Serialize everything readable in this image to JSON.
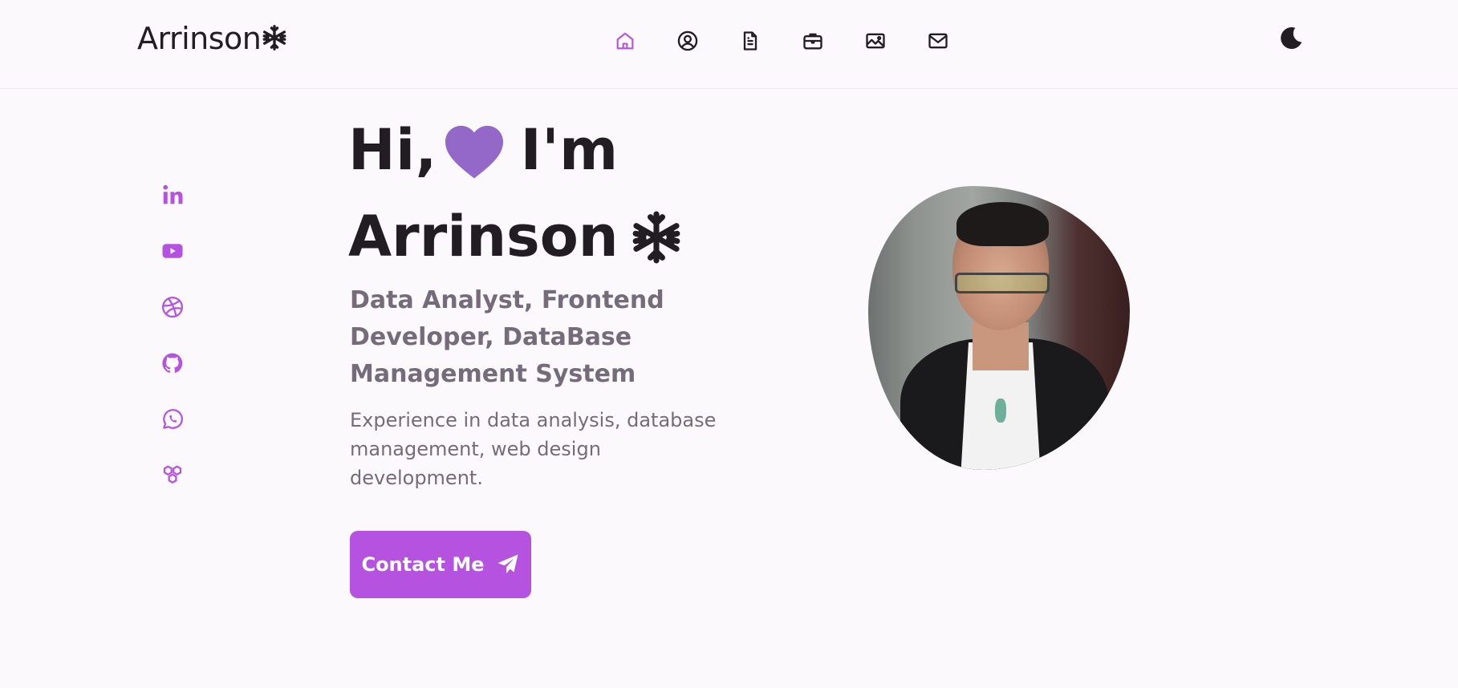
{
  "header": {
    "logo_text": "Arrinson",
    "nav": [
      {
        "name": "home",
        "icon": "home-icon",
        "active": true
      },
      {
        "name": "about",
        "icon": "user-circle-icon",
        "active": false
      },
      {
        "name": "skills",
        "icon": "file-icon",
        "active": false
      },
      {
        "name": "services",
        "icon": "briefcase-icon",
        "active": false
      },
      {
        "name": "portfolio",
        "icon": "image-icon",
        "active": false
      },
      {
        "name": "contact",
        "icon": "mail-icon",
        "active": false
      }
    ],
    "theme_icon": "moon-icon"
  },
  "social": [
    {
      "icon": "linkedin-icon"
    },
    {
      "icon": "youtube-icon"
    },
    {
      "icon": "dribbble-icon"
    },
    {
      "icon": "github-icon"
    },
    {
      "icon": "whatsapp-icon"
    },
    {
      "icon": "hexagons-icon"
    }
  ],
  "hero": {
    "greeting_prefix": "Hi,",
    "greeting_suffix": "I'm",
    "name": "Arrinson",
    "subtitle": "Data Analyst, Frontend Developer, DataBase Management System",
    "description": "Experience in data analysis, database management, web design development.",
    "button_label": "Contact Me"
  },
  "colors": {
    "accent": "#b553e0",
    "heart": "#9468c9",
    "text_dark": "#211d23",
    "text_muted": "#756b7b",
    "background": "#fcf9fd"
  }
}
